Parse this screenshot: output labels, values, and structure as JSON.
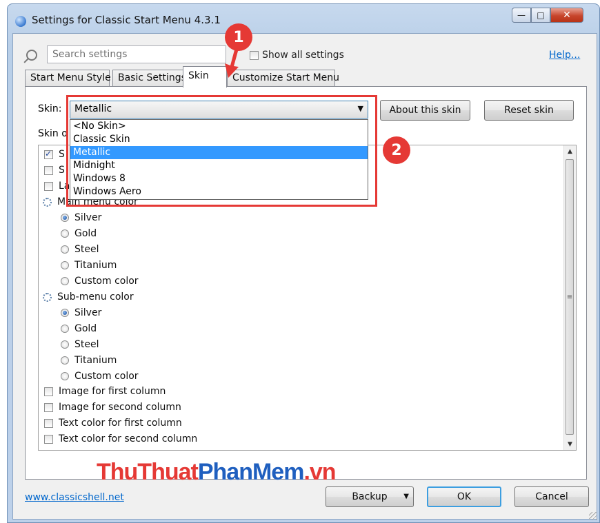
{
  "window": {
    "title": "Settings for Classic Start Menu 4.3.1",
    "controls": {
      "minimize": "—",
      "maximize": "□",
      "close": "✕"
    }
  },
  "search": {
    "placeholder": "Search settings",
    "show_all_label": "Show all settings",
    "show_all_checked": false
  },
  "help_link": "Help...",
  "tabs": [
    {
      "label": "Start Menu Style",
      "active": false
    },
    {
      "label": "Basic Settings",
      "active": false
    },
    {
      "label": "Skin",
      "active": true
    },
    {
      "label": "Customize Start Menu",
      "active": false
    }
  ],
  "skin": {
    "label": "Skin:",
    "selected": "Metallic",
    "options": [
      "<No Skin>",
      "Classic Skin",
      "Metallic",
      "Midnight",
      "Windows 8",
      "Windows Aero"
    ],
    "about_button": "About this skin",
    "reset_button": "Reset skin",
    "options_label": "Skin o"
  },
  "callouts": {
    "one": "1",
    "two": "2"
  },
  "options": {
    "partial_rows": [
      {
        "text": "S",
        "checked": true
      },
      {
        "text": "S",
        "checked": false
      },
      {
        "text": "La",
        "checked": false
      }
    ],
    "main_menu_color": {
      "label": "Main menu color",
      "choices": [
        "Silver",
        "Gold",
        "Steel",
        "Titanium",
        "Custom color"
      ],
      "selected": "Silver"
    },
    "sub_menu_color": {
      "label": "Sub-menu color",
      "choices": [
        "Silver",
        "Gold",
        "Steel",
        "Titanium",
        "Custom color"
      ],
      "selected": "Silver"
    },
    "checkboxes": [
      "Image for first column",
      "Image for second column",
      "Text color for first column",
      "Text color for second column"
    ]
  },
  "watermark": {
    "part1": "ThuThuat",
    "part2": "PhanMem",
    "part3": ".vn"
  },
  "footer": {
    "site_link": "www.classicshell.net",
    "backup": "Backup",
    "ok": "OK",
    "cancel": "Cancel"
  },
  "colors": {
    "highlight": "#e53935",
    "selection": "#3399ff",
    "link": "#0066cc"
  }
}
